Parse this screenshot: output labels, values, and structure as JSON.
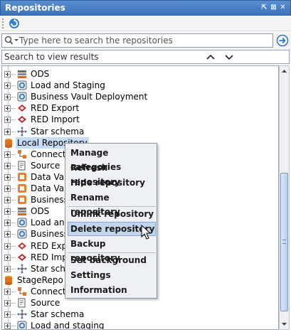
{
  "panel": {
    "title": "Repositories",
    "controls": [
      "⇱",
      "⊠",
      "✕"
    ]
  },
  "toolbar": {
    "refresh_icon": "refresh-icon"
  },
  "search": {
    "placeholder": "Type here to search the repositories"
  },
  "view": {
    "placeholder": "Search to view results"
  },
  "tree": {
    "rows": [
      {
        "label": "ODS",
        "icon": "ods-icon",
        "indent": 1
      },
      {
        "label": "Load and Staging",
        "icon": "load-icon",
        "indent": 1
      },
      {
        "label": "Business Vault Deployment",
        "icon": "load-icon",
        "indent": 1
      },
      {
        "label": "RED Export",
        "icon": "red-export-icon",
        "indent": 1
      },
      {
        "label": "RED Import",
        "icon": "red-import-icon",
        "indent": 1
      },
      {
        "label": "Star schema",
        "icon": "star-schema-icon",
        "indent": 1
      },
      {
        "label": "Local Repository",
        "icon": "repository-icon",
        "indent": 0
      },
      {
        "label": "Connecti",
        "icon": "connection-icon",
        "indent": 1
      },
      {
        "label": "Source",
        "icon": "source-icon",
        "indent": 1
      },
      {
        "label": "Data Vau",
        "icon": "datavault-icon",
        "indent": 1
      },
      {
        "label": "Data Vau",
        "icon": "datavault-icon",
        "indent": 1
      },
      {
        "label": "Business",
        "icon": "datavault-icon",
        "indent": 1
      },
      {
        "label": "ODS",
        "icon": "ods-icon",
        "indent": 1
      },
      {
        "label": "Load and",
        "icon": "load-icon",
        "indent": 1
      },
      {
        "label": "Business",
        "icon": "load-icon",
        "indent": 1
      },
      {
        "label": "RED Expo",
        "icon": "red-export-icon",
        "indent": 1
      },
      {
        "label": "RED Impo",
        "icon": "red-import-icon",
        "indent": 1
      },
      {
        "label": "Star sche",
        "icon": "star-schema-icon",
        "indent": 1
      },
      {
        "label": "StageRepo",
        "icon": "repository-icon",
        "indent": 0
      },
      {
        "label": "Connecti",
        "icon": "connection-icon",
        "indent": 1
      },
      {
        "label": "Source",
        "icon": "source-icon",
        "indent": 1
      },
      {
        "label": "Star schema",
        "icon": "star-schema-icon",
        "indent": 1
      },
      {
        "label": "Load and staging",
        "icon": "load-icon",
        "indent": 1
      }
    ]
  },
  "context_menu": {
    "items": [
      "Manage categories",
      "Refresh repository",
      "Hide repository",
      "Rename repository",
      "Unlink repository",
      "Delete repository",
      "Backup repository",
      "Set background",
      "Settings",
      "Information"
    ],
    "hovered": "Delete repository"
  }
}
